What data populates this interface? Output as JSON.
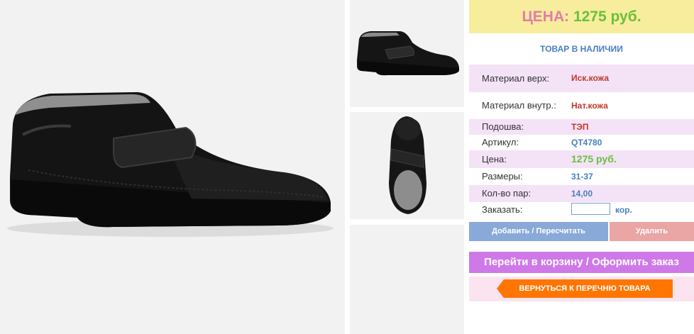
{
  "price_box": {
    "label": "ЦЕНА:",
    "value": "1275 руб."
  },
  "stock_status": "ТОВАР В НАЛИЧИИ",
  "specs": [
    {
      "label": "Материал верх:",
      "value": "Иск.кожа"
    },
    {
      "label": "Материал внутр.:",
      "value": "Нат.кожа"
    },
    {
      "label": "Подошва:",
      "value": "ТЭП"
    },
    {
      "label": "Артикул:",
      "value": "QT4780"
    },
    {
      "label": "Цена:",
      "value": "1275 руб."
    },
    {
      "label": "Размеры:",
      "value": "31-37"
    },
    {
      "label": "Кол-во пар:",
      "value": "14,00"
    }
  ],
  "order": {
    "label": "Заказать:",
    "value": "",
    "unit": "кор."
  },
  "buttons": {
    "add": "Добавить / Пересчитать",
    "remove": "Удалить",
    "cart": "Перейти в корзину / Оформить заказ",
    "back": "ВЕРНУТЬСЯ К ПЕРЕЧНЮ ТОВАРА"
  },
  "colors": {
    "price_bg": "#f8ed9d",
    "price_label": "#e47ba7",
    "price_value": "#69c03b",
    "add_btn": "#89a9d8",
    "remove_btn": "#eaa5a5",
    "cart_btn": "#cf79e8",
    "back_btn": "#fe7600"
  },
  "images": {
    "main": "black-velcro-shoe-side-view",
    "thumbs": [
      "black-velcro-shoe-side-view",
      "black-velcro-shoe-top-view",
      "empty"
    ]
  }
}
